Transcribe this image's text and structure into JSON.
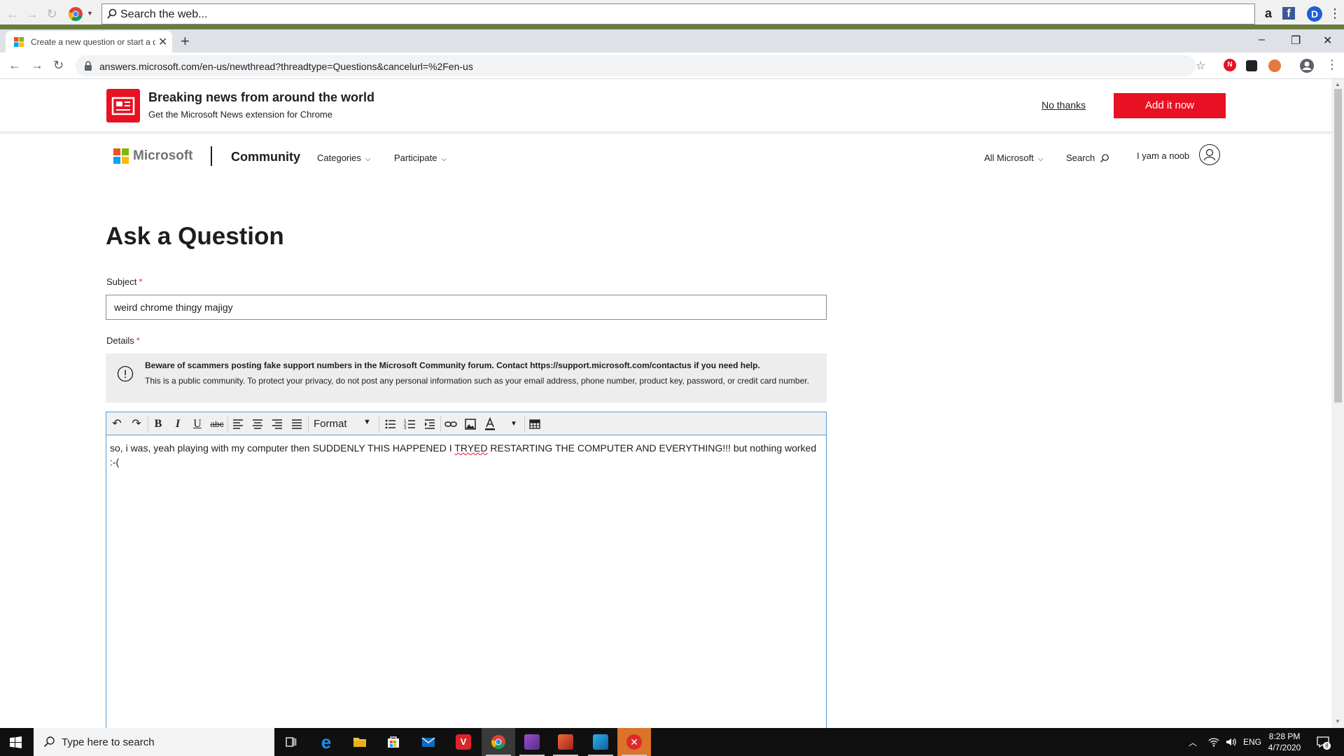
{
  "top_toolbar": {
    "search_placeholder": "Search the web...",
    "icons": [
      "back-icon",
      "forward-icon",
      "refresh-icon",
      "chrome-icon",
      "amazon-icon",
      "facebook-icon",
      "dashlane-icon",
      "menu-icon"
    ]
  },
  "tab": {
    "title": "Create a new question or start a discussion",
    "new_tab_label": "+"
  },
  "window_controls": {
    "minimize": "–",
    "restore": "❐",
    "close": "✕"
  },
  "address_bar": {
    "url": "answers.microsoft.com/en-us/newthread?threadtype=Questions&cancelurl=%2Fen-us"
  },
  "banner": {
    "title": "Breaking news from around the world",
    "subtitle": "Get the Microsoft News extension for Chrome",
    "dismiss_label": "No thanks",
    "cta_label": "Add it now",
    "accent_color": "#e81123"
  },
  "site_header": {
    "brand": "Microsoft",
    "section": "Community",
    "nav": [
      "Categories",
      "Participate"
    ],
    "all_microsoft": "All Microsoft",
    "search_label": "Search",
    "user_name": "I yam a noob"
  },
  "form": {
    "title": "Ask a Question",
    "subject_label": "Subject",
    "subject_value": "weird chrome thingy majigy",
    "details_label": "Details",
    "required_marker": "*",
    "warning_title": "Beware of scammers posting fake support numbers in the Microsoft Community forum. Contact https://support.microsoft.com/contactus if you need help.",
    "warning_body": "This is a public community. To protect your privacy, do not post any personal information such as your email address, phone number, product key, password, or credit card number.",
    "editor": {
      "format_label": "Format",
      "body_before": "so, i was, yeah playing with my computer then SUDDENLY THIS HAPPENED I ",
      "body_misspelled": "TRYED",
      "body_after": " RESTARTING THE COMPUTER AND EVERYTHING!!! but nothing worked :-("
    }
  },
  "taskbar": {
    "search_placeholder": "Type here to search",
    "language": "ENG",
    "time": "8:28 PM",
    "date": "4/7/2020",
    "notification_count": "8"
  }
}
